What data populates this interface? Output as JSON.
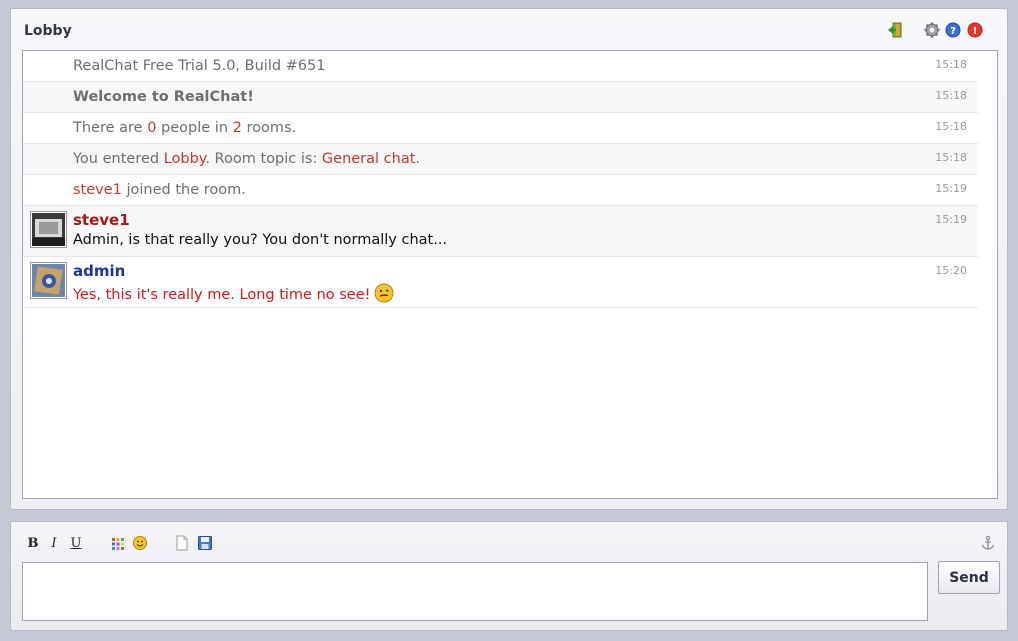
{
  "room": {
    "title": "Lobby"
  },
  "header_icons": [
    "exit-icon",
    "settings-icon",
    "help-icon",
    "close-icon"
  ],
  "messages": {
    "sys1": {
      "text": "RealChat Free Trial 5.0, Build #651",
      "time": "15:18"
    },
    "sys2": {
      "text": "Welcome to RealChat!",
      "time": "15:18"
    },
    "sys3": {
      "pre": "There are ",
      "people": "0",
      "mid": " people in ",
      "rooms": "2",
      "post": " rooms.",
      "time": "15:18"
    },
    "sys4": {
      "pre": "You entered ",
      "room": "Lobby",
      "mid": ". Room topic is: ",
      "topic": "General chat",
      "post": ".",
      "time": "15:18"
    },
    "sys5": {
      "user": "steve1",
      "rest": " joined the room.",
      "time": "15:19"
    },
    "msg1": {
      "user": "steve1",
      "text": "Admin, is that really you? You don't normally chat...",
      "time": "15:19"
    },
    "msg2": {
      "user": "admin",
      "text": "Yes, this it's really me. Long time no see!",
      "time": "15:20"
    }
  },
  "toolbar": {
    "bold": "B",
    "italic": "I",
    "underline": "U",
    "icons": [
      "color-palette-icon",
      "smiley-icon",
      "new-document-icon",
      "save-icon",
      "anchor-icon"
    ]
  },
  "input": {
    "value": "",
    "placeholder": ""
  },
  "send": {
    "label": "Send"
  },
  "colors": {
    "background": "#c6c8d6",
    "highlight": "#c0392b",
    "user_red": "#a81515",
    "user_blue": "#1a35a0",
    "admin_text": "#cc1a1a"
  }
}
